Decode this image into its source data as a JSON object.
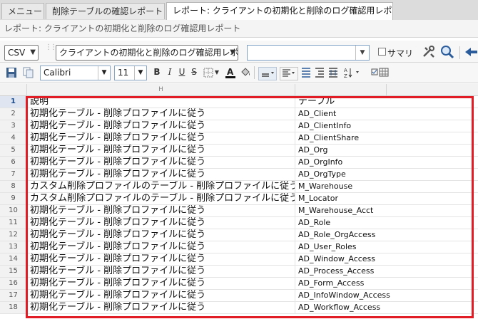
{
  "tabs": [
    {
      "label": "メニュー",
      "closable": false
    },
    {
      "label": "削除テーブルの確認レポート",
      "closable": true
    },
    {
      "label": "レポート: クライアントの初期化と削除のログ確認用レポート",
      "closable": true,
      "active": true
    }
  ],
  "close_glyph": "✖",
  "subtitle": "レポート: クライアントの初期化と削除のログ確認用レポート",
  "toolbar1": {
    "format_value": "CSV",
    "report_value": "クライアントの初期化と削除のログ確認用レポート",
    "combo_value": "",
    "summary_label": "サマリ"
  },
  "toolbar2": {
    "font_value": "Calibri",
    "size_value": "11"
  },
  "grid": {
    "column_header_letter": "H",
    "header_row": {
      "num": "1",
      "a": "説明",
      "b": "テーブル"
    },
    "rows": [
      {
        "num": "2",
        "a": "初期化テーブル - 削除プロファイルに従う",
        "b": "AD_Client"
      },
      {
        "num": "3",
        "a": "初期化テーブル - 削除プロファイルに従う",
        "b": "AD_ClientInfo"
      },
      {
        "num": "4",
        "a": "初期化テーブル - 削除プロファイルに従う",
        "b": "AD_ClientShare"
      },
      {
        "num": "5",
        "a": "初期化テーブル - 削除プロファイルに従う",
        "b": "AD_Org"
      },
      {
        "num": "6",
        "a": "初期化テーブル - 削除プロファイルに従う",
        "b": "AD_OrgInfo"
      },
      {
        "num": "7",
        "a": "初期化テーブル - 削除プロファイルに従う",
        "b": "AD_OrgType"
      },
      {
        "num": "8",
        "a": "カスタム削除プロファイルのテーブル - 削除プロファイルに従う",
        "b": "M_Warehouse"
      },
      {
        "num": "9",
        "a": "カスタム削除プロファイルのテーブル - 削除プロファイルに従う",
        "b": "M_Locator"
      },
      {
        "num": "10",
        "a": "初期化テーブル - 削除プロファイルに従う",
        "b": "M_Warehouse_Acct"
      },
      {
        "num": "11",
        "a": "初期化テーブル - 削除プロファイルに従う",
        "b": "AD_Role"
      },
      {
        "num": "12",
        "a": "初期化テーブル - 削除プロファイルに従う",
        "b": "AD_Role_OrgAccess"
      },
      {
        "num": "13",
        "a": "初期化テーブル - 削除プロファイルに従う",
        "b": "AD_User_Roles"
      },
      {
        "num": "14",
        "a": "初期化テーブル - 削除プロファイルに従う",
        "b": "AD_Window_Access"
      },
      {
        "num": "15",
        "a": "初期化テーブル - 削除プロファイルに従う",
        "b": "AD_Process_Access"
      },
      {
        "num": "16",
        "a": "初期化テーブル - 削除プロファイルに従う",
        "b": "AD_Form_Access"
      },
      {
        "num": "17",
        "a": "初期化テーブル - 削除プロファイルに従う",
        "b": "AD_InfoWindow_Access"
      },
      {
        "num": "18",
        "a": "初期化テーブル - 削除プロファイルに従う",
        "b": "AD_Workflow_Access"
      }
    ]
  },
  "colors": {
    "highlight": "#e11c24",
    "accent": "#1a4a8a"
  }
}
